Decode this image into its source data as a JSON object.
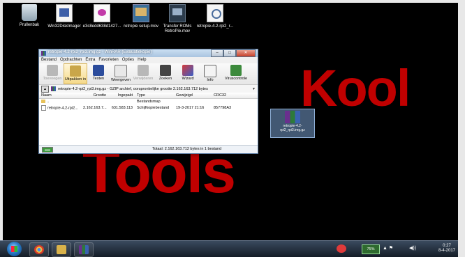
{
  "desktop": {
    "icons": [
      {
        "label": "Prullenbak",
        "icon": "recycle-bin-icon"
      },
      {
        "label": "Win32DiskImager",
        "icon": "disk-imager-icon"
      },
      {
        "label": "e3c8edd638d1427...",
        "icon": "document-icon"
      },
      {
        "label": "retropie setup.mov",
        "icon": "movie-icon"
      },
      {
        "label": "Transfer ROMs RetroPie.mov",
        "icon": "movie-icon"
      },
      {
        "label": "retropie-4.2-rpi2_r...",
        "icon": "zip-file-icon"
      }
    ],
    "selected_file": {
      "label": "retropie-4.2-rpi2_rpi3.img.gz",
      "icon": "winrar-archive-icon"
    },
    "wallpaper": {
      "line1": "Kool",
      "line2": "Tools",
      "color": "#c00000"
    }
  },
  "window": {
    "title": "retropie-4.2-rpi2_rpi3.img.gz - WinRAR (Evaluatiekopie)",
    "controls": {
      "minimize": "–",
      "maximize": "□",
      "close": "✕"
    },
    "menu": [
      "Bestand",
      "Opdrachten",
      "Extra",
      "Favorieten",
      "Opties",
      "Help"
    ],
    "toolbar": [
      {
        "label": "Toevoegen",
        "icon": "add-icon",
        "enabled": false
      },
      {
        "label": "Uitpakken in",
        "icon": "extract-icon",
        "enabled": true,
        "active": true
      },
      {
        "label": "Testen",
        "icon": "test-icon",
        "enabled": true
      },
      {
        "label": "Weergeven",
        "icon": "view-icon",
        "enabled": true
      },
      {
        "label": "Verwijderen",
        "icon": "delete-icon",
        "enabled": false
      },
      {
        "label": "Zoeken",
        "icon": "find-icon",
        "enabled": true
      },
      {
        "label": "Wizard",
        "icon": "wizard-icon",
        "enabled": true
      },
      {
        "label": "Info",
        "icon": "info-icon",
        "enabled": true
      },
      {
        "label": "Viruscontrole",
        "icon": "virus-scan-icon",
        "enabled": true
      }
    ],
    "path": "retropie-4.2-rpi2_rpi3.img.gz - GZIP archief, oorspronkelijke grootte 2.162.163.712 bytes",
    "columns": [
      "Naam",
      "Grootte",
      "Ingepakt",
      "Type",
      "Gewijzigd",
      "CRC32"
    ],
    "rows": [
      {
        "name": "..",
        "size": "",
        "packed": "",
        "type": "Bestandsmap",
        "modified": "",
        "crc": ""
      },
      {
        "name": "retropie-4.2-rpi2...",
        "size": "2.162.163.7...",
        "packed": "631.583.113",
        "type": "Schijfkopiebestand",
        "modified": "19-3-2017 21:16",
        "crc": "857798A3"
      }
    ],
    "status": {
      "drive": "▬▬",
      "total": "Totaal: 2.162.163.712 bytes in 1 bestand"
    }
  },
  "taskbar": {
    "apps": [
      {
        "name": "chrome",
        "icon": "chrome-icon"
      },
      {
        "name": "explorer",
        "icon": "folder-icon"
      },
      {
        "name": "winrar",
        "icon": "winrar-icon"
      }
    ],
    "battery": "75%",
    "time": "0:27",
    "date": "8-4-2017"
  }
}
